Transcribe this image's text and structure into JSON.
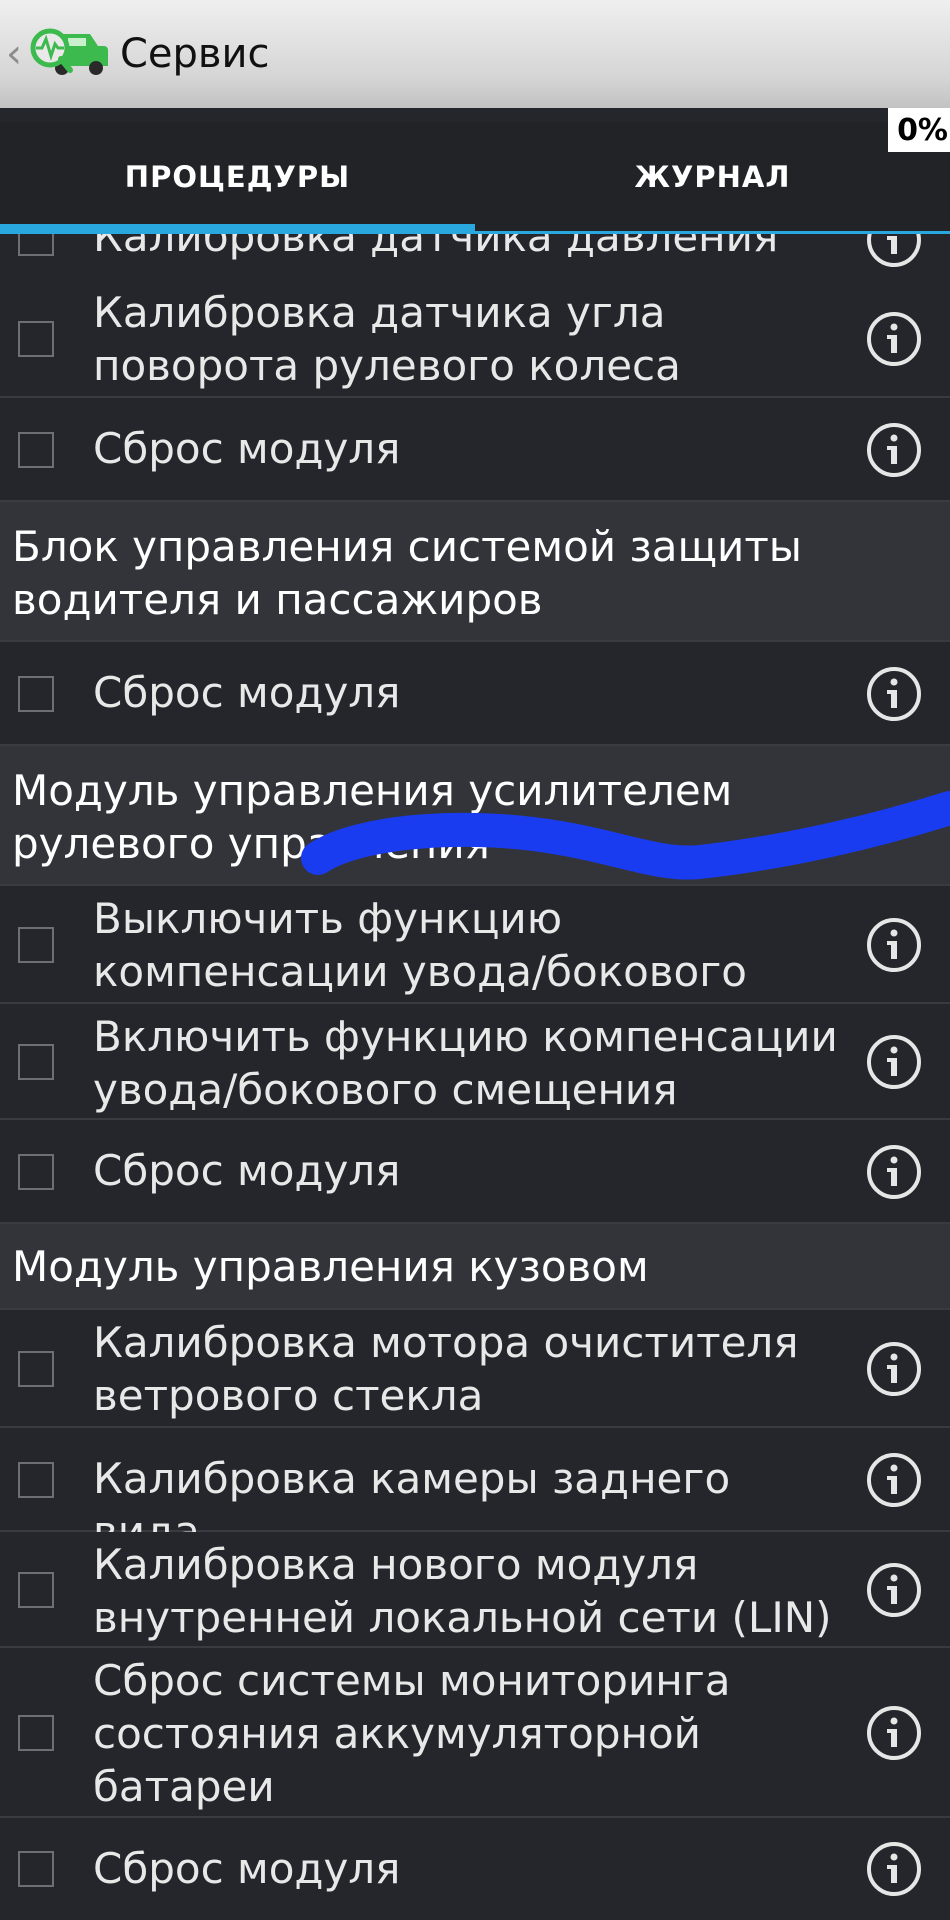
{
  "app": {
    "title": "Сервис",
    "back_icon": "chevron-left-icon",
    "logo_icon": "car-diagnostic-icon",
    "progress_text": "0%"
  },
  "tabs": [
    {
      "label": "ПРОЦЕДУРЫ",
      "active": true
    },
    {
      "label": "ЖУРНАЛ",
      "active": false
    }
  ],
  "colors": {
    "accent": "#29a8e0",
    "scribble": "#1a3cf0",
    "logo_green": "#3dba4e"
  },
  "list": {
    "partial_row": "Калибровка датчика давления",
    "r1": "Калибровка датчика угла поворота рулевого колеса",
    "r2": "Сброс модуля",
    "h1": "Блок управления системой защиты водителя и пассажиров",
    "r3": "Сброс модуля",
    "h2": "Модуль управления усилителем рулевого управления",
    "r4": "Выключить функцию компенсации увода/бокового смещения",
    "r5": "Включить функцию компенсации увода/бокового смещения",
    "r6": "Сброс модуля",
    "h3": "Модуль управления кузовом",
    "r7": "Калибровка мотора очистителя ветрового стекла",
    "r8": "Калибровка камеры заднего вида",
    "r9": "Калибровка нового модуля внутренней локальной сети (LIN)",
    "r10": "Сброс системы мониторинга состояния аккумуляторной батареи",
    "r11": "Сброс модуля"
  }
}
